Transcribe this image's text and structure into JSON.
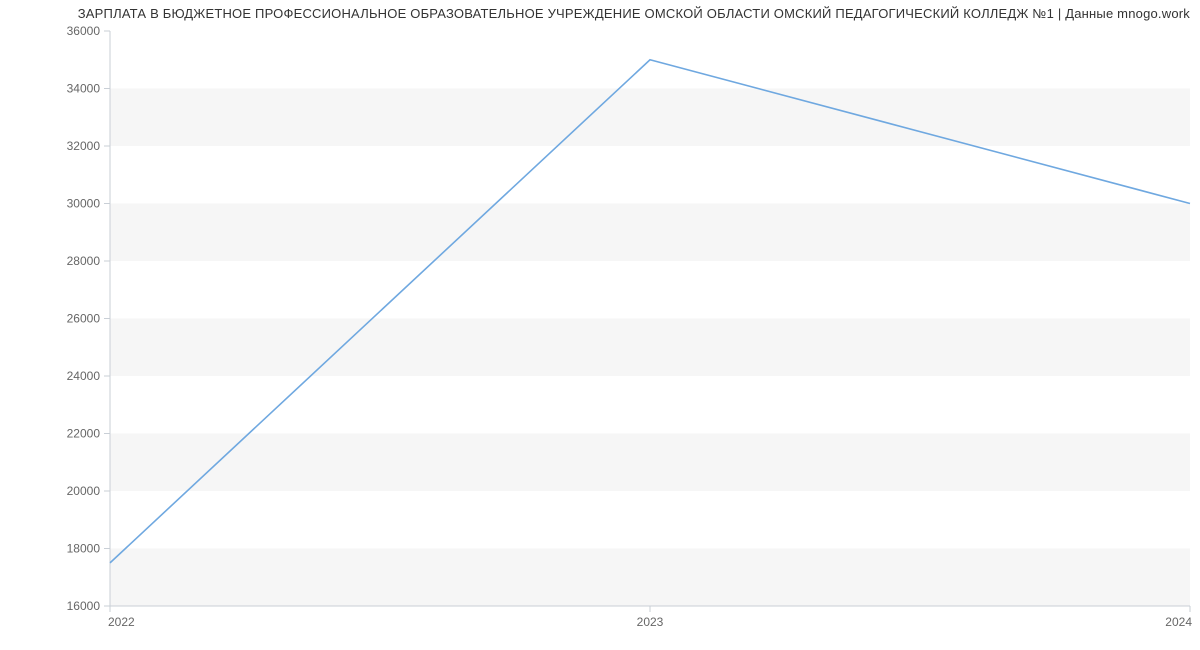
{
  "chart_data": {
    "type": "line",
    "title": "ЗАРПЛАТА В БЮДЖЕТНОЕ ПРОФЕССИОНАЛЬНОЕ ОБРАЗОВАТЕЛЬНОЕ УЧРЕЖДЕНИЕ ОМСКОЙ ОБЛАСТИ ОМСКИЙ ПЕДАГОГИЧЕСКИЙ КОЛЛЕДЖ №1 | Данные mnogo.work",
    "xlabel": "",
    "ylabel": "",
    "x_ticks": [
      "2022",
      "2023",
      "2024"
    ],
    "y_ticks": [
      16000,
      18000,
      20000,
      22000,
      24000,
      26000,
      28000,
      30000,
      32000,
      34000,
      36000
    ],
    "ylim": [
      16000,
      36000
    ],
    "series": [
      {
        "name": "salary",
        "x": [
          2022,
          2023,
          2024
        ],
        "values": [
          17500,
          35000,
          30000
        ]
      }
    ],
    "colors": {
      "line": "#6fa8e0",
      "grid_band": "#f6f6f6",
      "axis": "#c9cfd6",
      "text": "#666666"
    }
  }
}
